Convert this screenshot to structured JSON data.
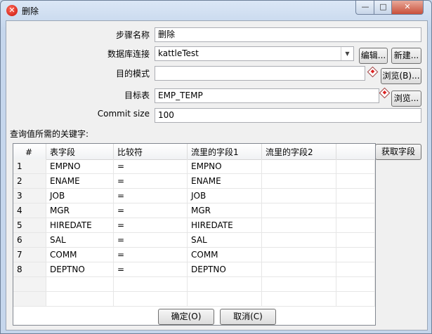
{
  "window": {
    "title": "删除",
    "minimize": "—",
    "maximize": "□",
    "close": "✕"
  },
  "form": {
    "step_name_label": "步骤名称",
    "step_name_value": "删除",
    "connection_label": "数据库连接",
    "connection_value": "kattleTest",
    "edit_button": "编辑...",
    "new_button": "新建...",
    "schema_label": "目的模式",
    "schema_value": "",
    "browse_b_button": "浏览(B)...",
    "table_label": "目标表",
    "table_value": "EMP_TEMP",
    "browse_button": "浏览...",
    "commit_label": "Commit size",
    "commit_value": "100"
  },
  "keys": {
    "section_label": "查询值所需的关键字:",
    "get_fields_button": "获取字段",
    "columns": [
      "#",
      "表字段",
      "比较符",
      "流里的字段1",
      "流里的字段2"
    ],
    "rows": [
      [
        "1",
        "EMPNO",
        "=",
        "EMPNO",
        ""
      ],
      [
        "2",
        "ENAME",
        "=",
        "ENAME",
        ""
      ],
      [
        "3",
        "JOB",
        "=",
        "JOB",
        ""
      ],
      [
        "4",
        "MGR",
        "=",
        "MGR",
        ""
      ],
      [
        "5",
        "HIREDATE",
        "=",
        "HIREDATE",
        ""
      ],
      [
        "6",
        "SAL",
        "=",
        "SAL",
        ""
      ],
      [
        "7",
        "COMM",
        "=",
        "COMM",
        ""
      ],
      [
        "8",
        "DEPTNO",
        "=",
        "DEPTNO",
        ""
      ]
    ]
  },
  "footer": {
    "ok_button": "确定(O)",
    "cancel_button": "取消(C)"
  }
}
